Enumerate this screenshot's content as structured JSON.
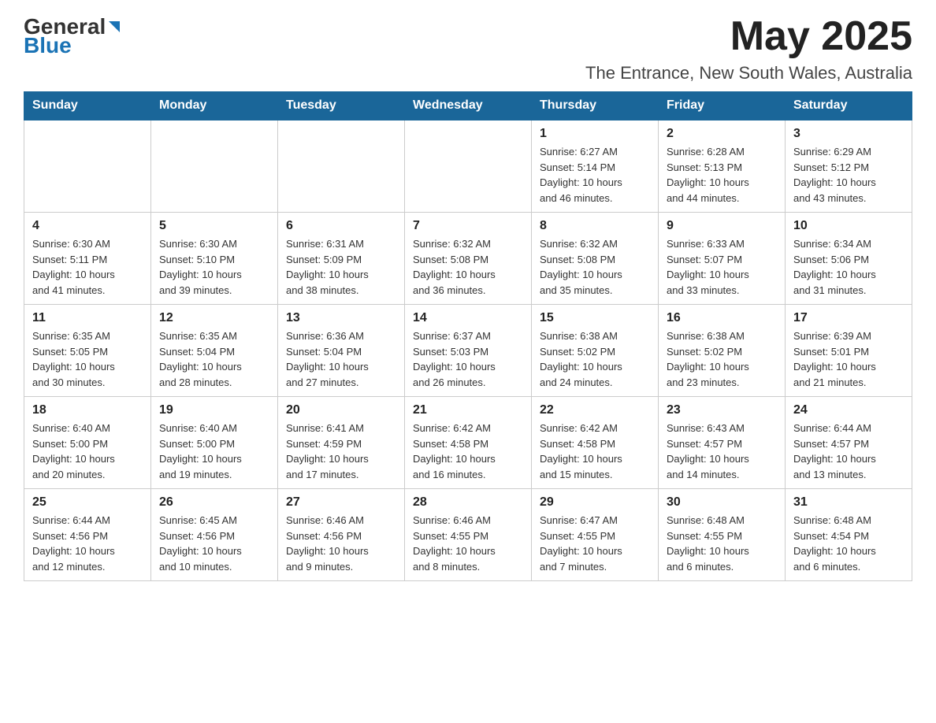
{
  "header": {
    "logo_general": "General",
    "logo_blue": "Blue",
    "month_year": "May 2025",
    "location": "The Entrance, New South Wales, Australia"
  },
  "weekdays": [
    "Sunday",
    "Monday",
    "Tuesday",
    "Wednesday",
    "Thursday",
    "Friday",
    "Saturday"
  ],
  "weeks": [
    [
      {
        "day": "",
        "info": ""
      },
      {
        "day": "",
        "info": ""
      },
      {
        "day": "",
        "info": ""
      },
      {
        "day": "",
        "info": ""
      },
      {
        "day": "1",
        "info": "Sunrise: 6:27 AM\nSunset: 5:14 PM\nDaylight: 10 hours\nand 46 minutes."
      },
      {
        "day": "2",
        "info": "Sunrise: 6:28 AM\nSunset: 5:13 PM\nDaylight: 10 hours\nand 44 minutes."
      },
      {
        "day": "3",
        "info": "Sunrise: 6:29 AM\nSunset: 5:12 PM\nDaylight: 10 hours\nand 43 minutes."
      }
    ],
    [
      {
        "day": "4",
        "info": "Sunrise: 6:30 AM\nSunset: 5:11 PM\nDaylight: 10 hours\nand 41 minutes."
      },
      {
        "day": "5",
        "info": "Sunrise: 6:30 AM\nSunset: 5:10 PM\nDaylight: 10 hours\nand 39 minutes."
      },
      {
        "day": "6",
        "info": "Sunrise: 6:31 AM\nSunset: 5:09 PM\nDaylight: 10 hours\nand 38 minutes."
      },
      {
        "day": "7",
        "info": "Sunrise: 6:32 AM\nSunset: 5:08 PM\nDaylight: 10 hours\nand 36 minutes."
      },
      {
        "day": "8",
        "info": "Sunrise: 6:32 AM\nSunset: 5:08 PM\nDaylight: 10 hours\nand 35 minutes."
      },
      {
        "day": "9",
        "info": "Sunrise: 6:33 AM\nSunset: 5:07 PM\nDaylight: 10 hours\nand 33 minutes."
      },
      {
        "day": "10",
        "info": "Sunrise: 6:34 AM\nSunset: 5:06 PM\nDaylight: 10 hours\nand 31 minutes."
      }
    ],
    [
      {
        "day": "11",
        "info": "Sunrise: 6:35 AM\nSunset: 5:05 PM\nDaylight: 10 hours\nand 30 minutes."
      },
      {
        "day": "12",
        "info": "Sunrise: 6:35 AM\nSunset: 5:04 PM\nDaylight: 10 hours\nand 28 minutes."
      },
      {
        "day": "13",
        "info": "Sunrise: 6:36 AM\nSunset: 5:04 PM\nDaylight: 10 hours\nand 27 minutes."
      },
      {
        "day": "14",
        "info": "Sunrise: 6:37 AM\nSunset: 5:03 PM\nDaylight: 10 hours\nand 26 minutes."
      },
      {
        "day": "15",
        "info": "Sunrise: 6:38 AM\nSunset: 5:02 PM\nDaylight: 10 hours\nand 24 minutes."
      },
      {
        "day": "16",
        "info": "Sunrise: 6:38 AM\nSunset: 5:02 PM\nDaylight: 10 hours\nand 23 minutes."
      },
      {
        "day": "17",
        "info": "Sunrise: 6:39 AM\nSunset: 5:01 PM\nDaylight: 10 hours\nand 21 minutes."
      }
    ],
    [
      {
        "day": "18",
        "info": "Sunrise: 6:40 AM\nSunset: 5:00 PM\nDaylight: 10 hours\nand 20 minutes."
      },
      {
        "day": "19",
        "info": "Sunrise: 6:40 AM\nSunset: 5:00 PM\nDaylight: 10 hours\nand 19 minutes."
      },
      {
        "day": "20",
        "info": "Sunrise: 6:41 AM\nSunset: 4:59 PM\nDaylight: 10 hours\nand 17 minutes."
      },
      {
        "day": "21",
        "info": "Sunrise: 6:42 AM\nSunset: 4:58 PM\nDaylight: 10 hours\nand 16 minutes."
      },
      {
        "day": "22",
        "info": "Sunrise: 6:42 AM\nSunset: 4:58 PM\nDaylight: 10 hours\nand 15 minutes."
      },
      {
        "day": "23",
        "info": "Sunrise: 6:43 AM\nSunset: 4:57 PM\nDaylight: 10 hours\nand 14 minutes."
      },
      {
        "day": "24",
        "info": "Sunrise: 6:44 AM\nSunset: 4:57 PM\nDaylight: 10 hours\nand 13 minutes."
      }
    ],
    [
      {
        "day": "25",
        "info": "Sunrise: 6:44 AM\nSunset: 4:56 PM\nDaylight: 10 hours\nand 12 minutes."
      },
      {
        "day": "26",
        "info": "Sunrise: 6:45 AM\nSunset: 4:56 PM\nDaylight: 10 hours\nand 10 minutes."
      },
      {
        "day": "27",
        "info": "Sunrise: 6:46 AM\nSunset: 4:56 PM\nDaylight: 10 hours\nand 9 minutes."
      },
      {
        "day": "28",
        "info": "Sunrise: 6:46 AM\nSunset: 4:55 PM\nDaylight: 10 hours\nand 8 minutes."
      },
      {
        "day": "29",
        "info": "Sunrise: 6:47 AM\nSunset: 4:55 PM\nDaylight: 10 hours\nand 7 minutes."
      },
      {
        "day": "30",
        "info": "Sunrise: 6:48 AM\nSunset: 4:55 PM\nDaylight: 10 hours\nand 6 minutes."
      },
      {
        "day": "31",
        "info": "Sunrise: 6:48 AM\nSunset: 4:54 PM\nDaylight: 10 hours\nand 6 minutes."
      }
    ]
  ]
}
